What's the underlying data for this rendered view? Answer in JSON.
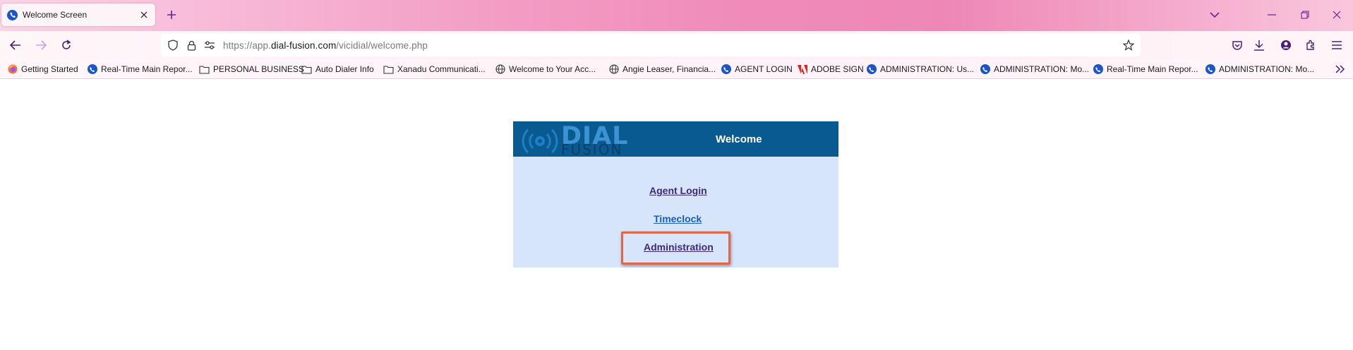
{
  "tab": {
    "title": "Welcome Screen"
  },
  "url": {
    "prefix": "https://app.",
    "domain": "dial-fusion.com",
    "path": "/vicidial/welcome.php"
  },
  "bookmarks": [
    {
      "label": "Getting Started",
      "icon": "firefox-icon"
    },
    {
      "label": "Real-Time Main Repor...",
      "icon": "vicidial-icon"
    },
    {
      "label": "PERSONAL BUSINESS",
      "icon": "folder-icon"
    },
    {
      "label": "Auto Dialer Info",
      "icon": "folder-icon"
    },
    {
      "label": "Xanadu Communicati...",
      "icon": "folder-icon"
    },
    {
      "label": "Welcome to Your Acc...",
      "icon": "globe-icon"
    },
    {
      "label": "Angie Leaser, Financia...",
      "icon": "globe-icon"
    },
    {
      "label": "AGENT LOGIN",
      "icon": "vicidial-icon"
    },
    {
      "label": "ADOBE SIGN",
      "icon": "adobe-icon"
    },
    {
      "label": "ADMINISTRATION: Us...",
      "icon": "vicidial-icon"
    },
    {
      "label": "ADMINISTRATION: Mo...",
      "icon": "vicidial-icon"
    },
    {
      "label": "Real-Time Main Repor...",
      "icon": "vicidial-icon"
    },
    {
      "label": "ADMINISTRATION: Mo...",
      "icon": "vicidial-icon"
    }
  ],
  "panel": {
    "logo_top": "DIAL",
    "logo_bottom": "FUSION",
    "title": "Welcome",
    "links": {
      "agent_login": "Agent Login",
      "timeclock": "Timeclock",
      "administration": "Administration"
    }
  },
  "colors": {
    "header": "#0a5a92",
    "body": "#d7e5fb",
    "highlight": "#e0664a",
    "visited_link": "#3d2a7a",
    "link": "#1a5fbf"
  }
}
